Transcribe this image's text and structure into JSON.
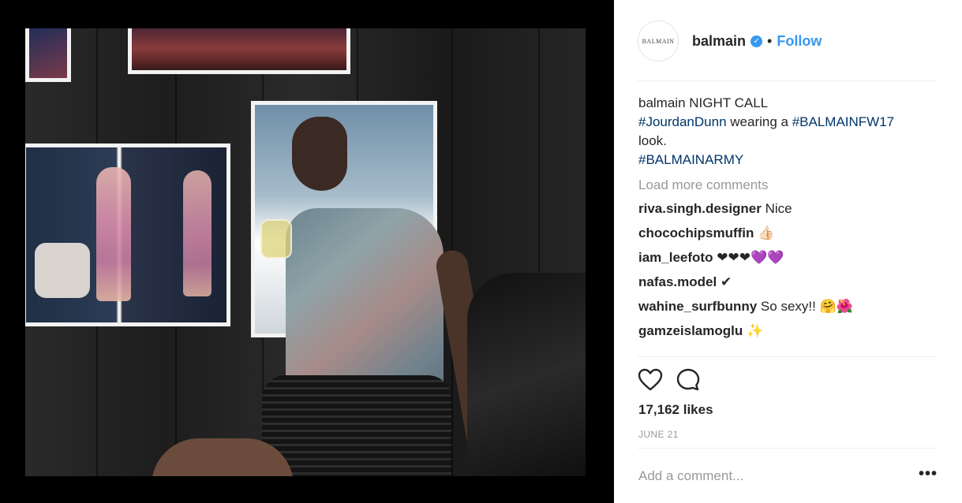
{
  "post": {
    "account": {
      "avatar_text": "BALMAIN",
      "username": "balmain",
      "verified": true,
      "separator": "•",
      "follow_label": "Follow"
    },
    "caption": {
      "username": "balmain",
      "line1": "NIGHT CALL",
      "hashtag1": "#JourdanDunn",
      "text_mid": " wearing a ",
      "hashtag2": "#BALMAINFW17",
      "text_end": "look.",
      "hashtag3": "#BALMAINARMY"
    },
    "load_more_label": "Load more comments",
    "comments": [
      {
        "username": "riva.singh.designer",
        "text": "Nice"
      },
      {
        "username": "chocochipsmuffin",
        "text": "👍🏻"
      },
      {
        "username": "iam_leefoto",
        "text": "❤❤❤💜💜"
      },
      {
        "username": "nafas.model",
        "text": "✔"
      },
      {
        "username": "wahine_surfbunny",
        "text": "So sexy!! 🤗🌺"
      },
      {
        "username": "gamzeislamoglu",
        "text": "✨"
      }
    ],
    "icons": {
      "like": "heart-icon",
      "comment": "speech-bubble-icon",
      "more": "ellipsis-icon"
    },
    "likes_label": "17,162 likes",
    "date_label": "JUNE 21",
    "add_comment_placeholder": "Add a comment...",
    "more_label": "•••",
    "colors": {
      "link": "#3897f0",
      "hashtag": "#003569",
      "muted": "#999999",
      "text": "#262626"
    }
  }
}
